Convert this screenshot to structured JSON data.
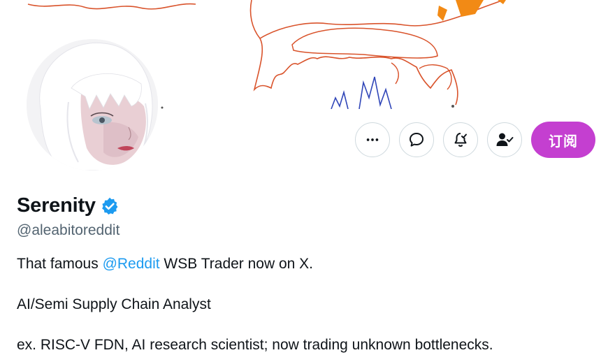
{
  "colors": {
    "accent_subscribe": "#c43fd0",
    "link": "#1d9bf0",
    "verified": "#1d9bf0",
    "secondary_text": "#536471",
    "primary_text": "#0f1419",
    "button_border": "#cfd9de"
  },
  "header": {
    "banner": "hand-drawn sketch banner",
    "avatar": "profile avatar illustration"
  },
  "actions": {
    "more_icon": "more-horizontal-icon",
    "message_icon": "message-bubble-icon",
    "notify_icon": "bell-check-icon",
    "follow_icon": "person-check-icon",
    "subscribe_label": "订阅"
  },
  "profile": {
    "display_name": "Serenity",
    "verified": true,
    "handle": "@aleabitoreddit",
    "bio": {
      "line1_before": "That famous ",
      "line1_mention": "@Reddit",
      "line1_after": " WSB Trader now on X.",
      "line2": "AI/Semi Supply Chain Analyst",
      "line3": "ex. RISC-V FDN, AI research scientist; now trading unknown bottlenecks."
    }
  }
}
